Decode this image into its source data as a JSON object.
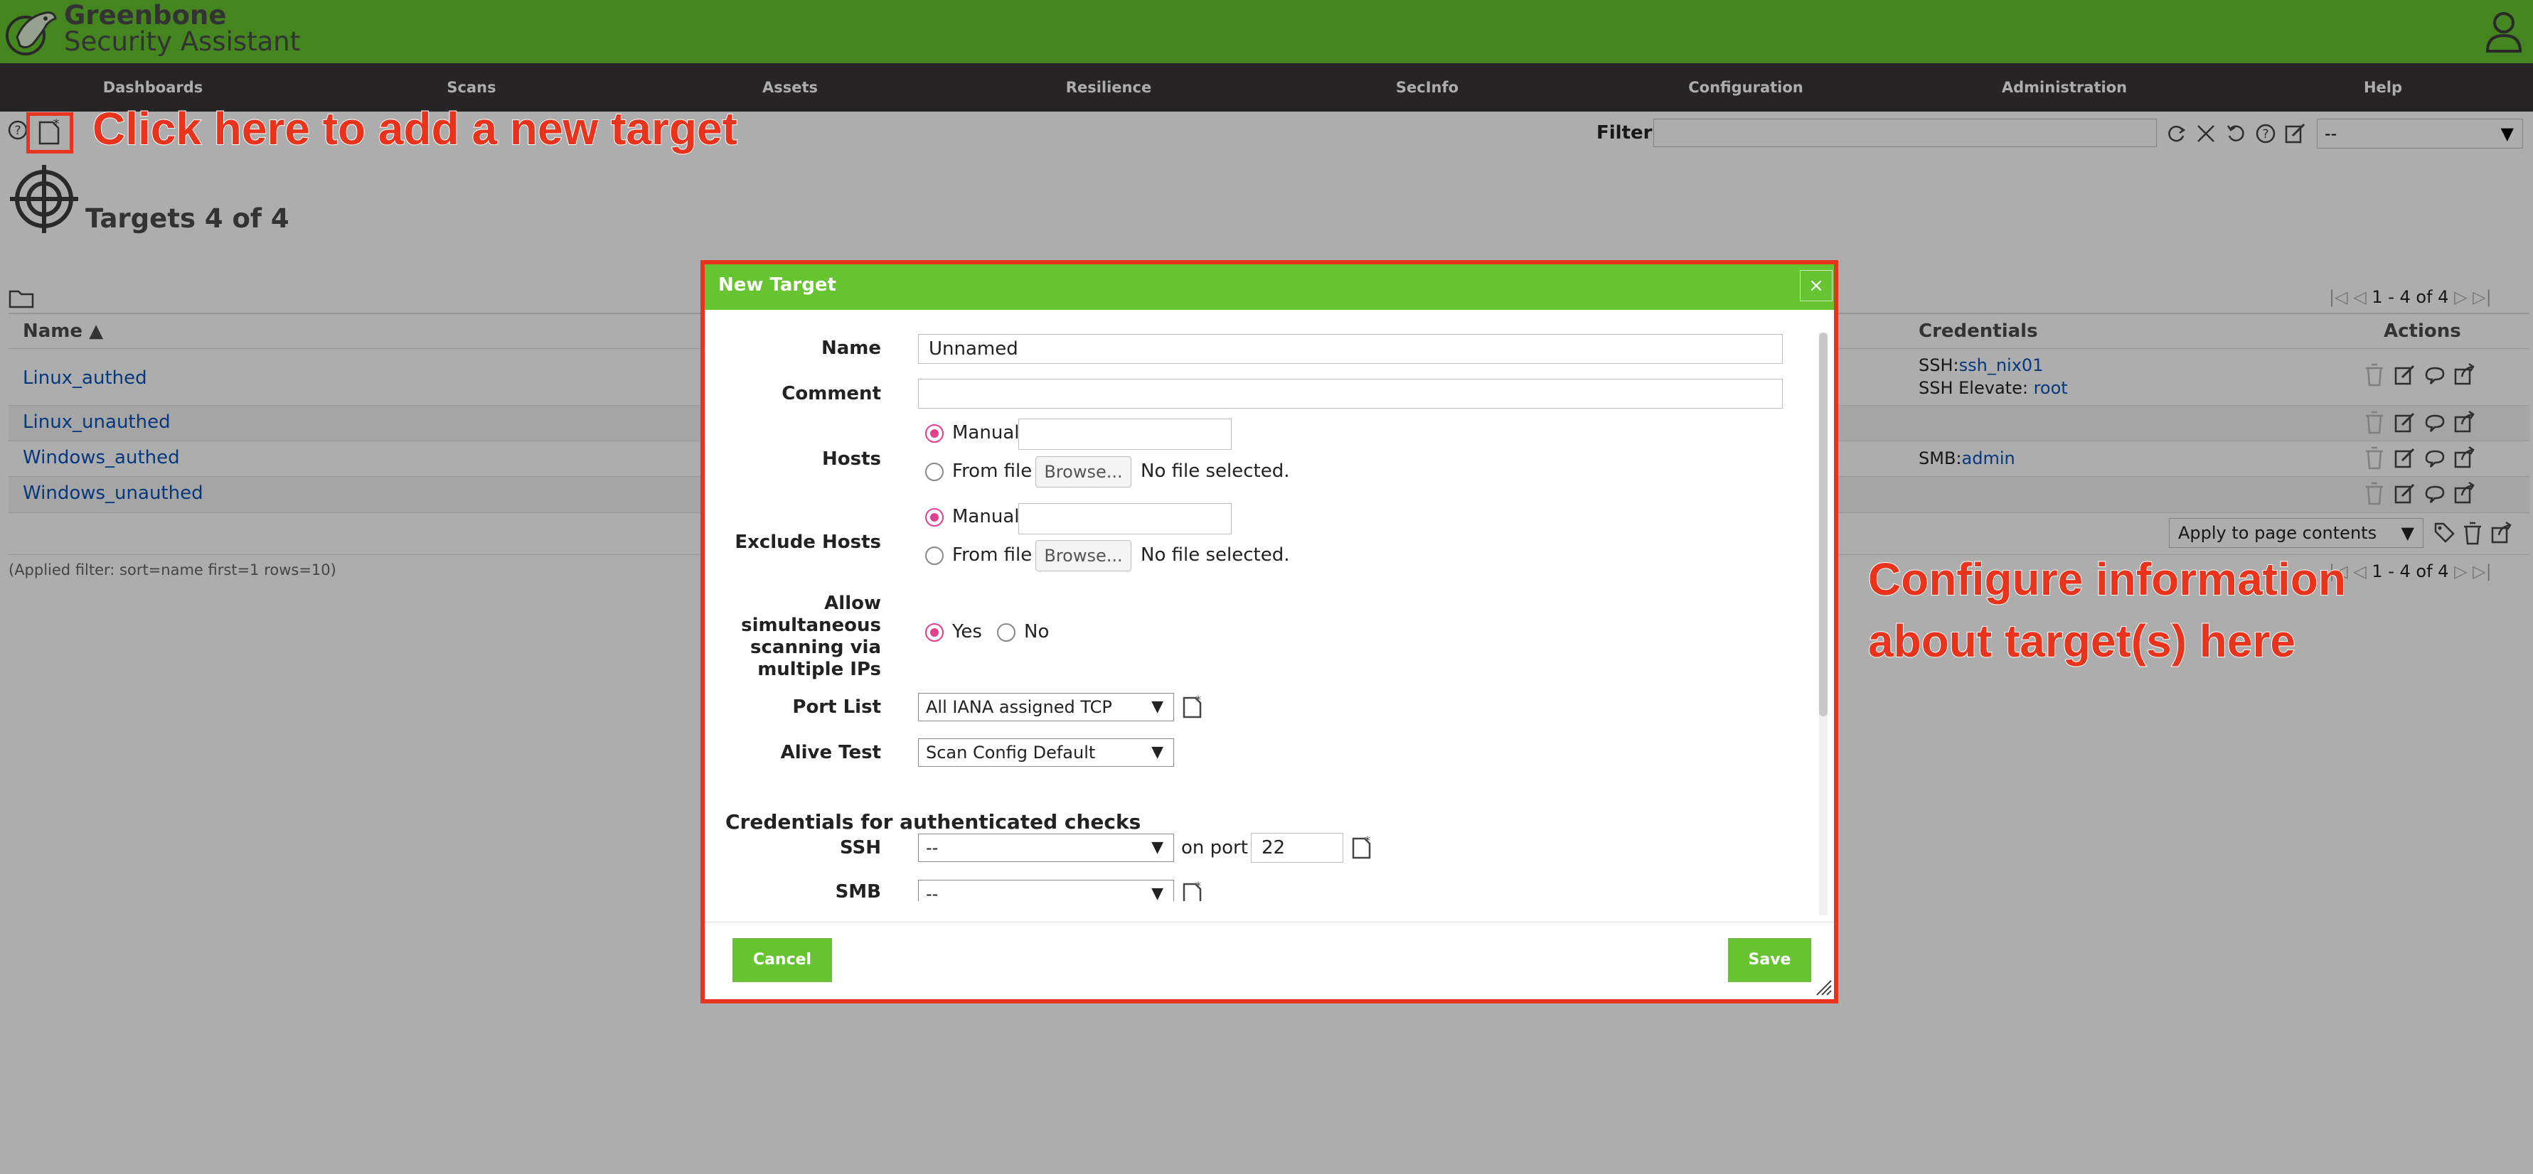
{
  "header": {
    "brand_line1": "Greenbone",
    "brand_line2": "Security Assistant"
  },
  "nav": [
    "Dashboards",
    "Scans",
    "Assets",
    "Resilience",
    "SecInfo",
    "Configuration",
    "Administration",
    "Help"
  ],
  "toolbar": {
    "filter_label": "Filter",
    "filter_value": "",
    "filter_select": "--"
  },
  "page": {
    "title": "Targets 4 of 4"
  },
  "table": {
    "columns": {
      "name": "Name ▲",
      "credentials": "Credentials",
      "actions": "Actions"
    },
    "rows": [
      {
        "name": "Linux_authed",
        "cred_line1_prefix": "SSH:",
        "cred_line1_link": "ssh_nix01",
        "cred_line2_prefix": "SSH Elevate:",
        "cred_line2_link": "root"
      },
      {
        "name": "Linux_unauthed"
      },
      {
        "name": "Windows_authed",
        "cred_line1_prefix": "SMB:",
        "cred_line1_link": "admin"
      },
      {
        "name": "Windows_unauthed"
      }
    ],
    "pagination": "1 - 4 of 4",
    "applied_filter": "(Applied filter: sort=name first=1 rows=10)",
    "bulk_select": "Apply to page contents"
  },
  "annotations": {
    "add_target": "Click here to add a new target",
    "configure_line1": "Configure information",
    "configure_line2": "about target(s) here"
  },
  "dialog": {
    "title": "New Target",
    "close": "×",
    "labels": {
      "name": "Name",
      "comment": "Comment",
      "hosts": "Hosts",
      "exclude_hosts": "Exclude Hosts",
      "allow_line1": "Allow",
      "allow_line2": "simultaneous",
      "allow_line3": "scanning via",
      "allow_line4": "multiple IPs",
      "port_list": "Port List",
      "alive_test": "Alive Test",
      "credentials_heading": "Credentials for authenticated checks",
      "ssh": "SSH",
      "smb": "SMB",
      "on_port": "on port"
    },
    "values": {
      "name": "Unnamed",
      "comment": "",
      "hosts_manual": "",
      "exclude_manual": "",
      "ssh_port": "22"
    },
    "options": {
      "manual": "Manual",
      "from_file": "From file",
      "browse": "Browse...",
      "no_file": "No file selected.",
      "yes": "Yes",
      "no": "No",
      "port_list_selected": "All IANA assigned TCP",
      "alive_test_selected": "Scan Config Default",
      "ssh_selected": "--",
      "smb_selected": "--"
    },
    "buttons": {
      "cancel": "Cancel",
      "save": "Save"
    }
  },
  "colors": {
    "brand_green": "#66c430",
    "nav_dark": "#393637",
    "annotation_red": "#e8331d",
    "link_blue": "#0a53b8",
    "radio_pink": "#e0418c"
  },
  "icons": [
    "logo-icon",
    "user-icon",
    "help-icon",
    "new-icon",
    "refresh-icon",
    "reset-filter-icon",
    "undo-icon",
    "filter-help-icon",
    "edit-filter-icon",
    "target-icon",
    "folder-icon",
    "trash-icon",
    "edit-icon",
    "clone-icon",
    "export-icon",
    "tag-icon"
  ]
}
